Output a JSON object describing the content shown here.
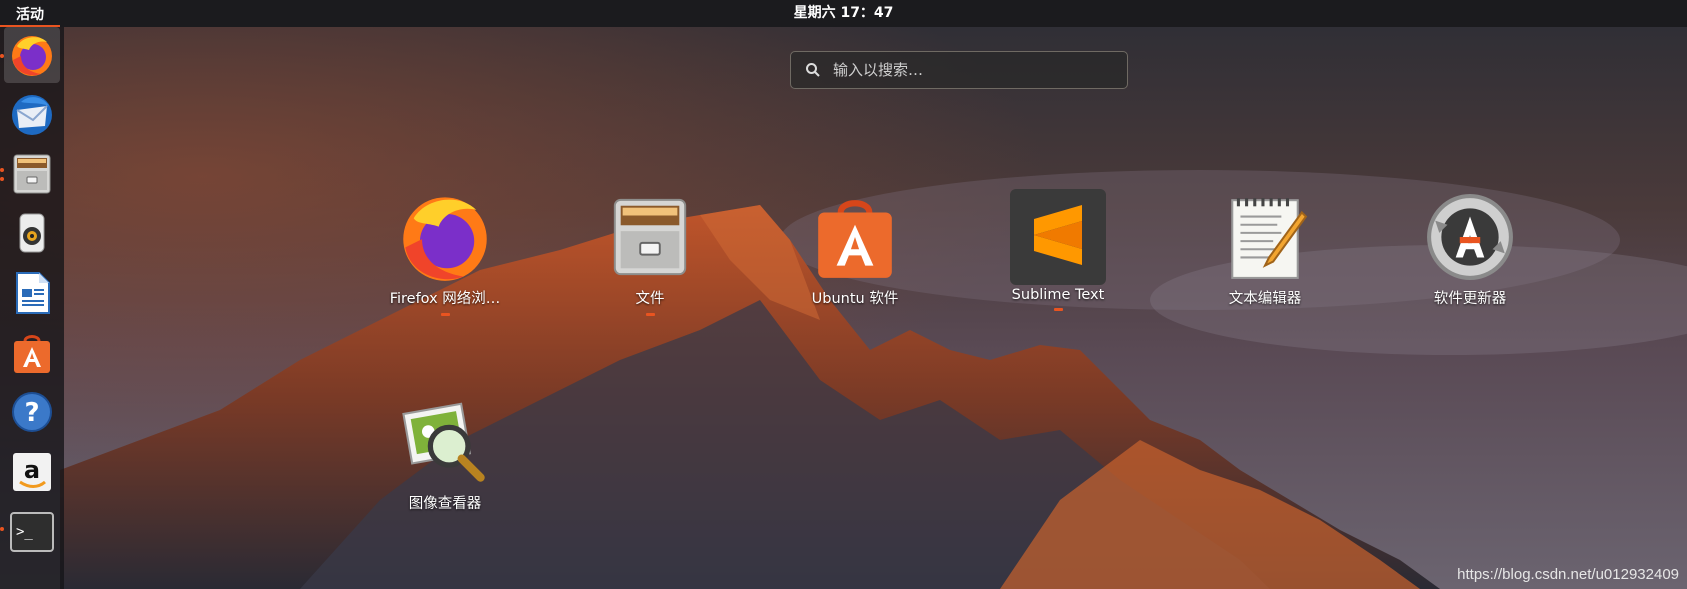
{
  "topbar": {
    "activities_label": "活动",
    "clock": "星期六 17：47"
  },
  "search": {
    "placeholder": "输入以搜索…"
  },
  "dock": {
    "items": [
      {
        "name": "firefox",
        "icon": "firefox-icon",
        "running": true,
        "active": true
      },
      {
        "name": "thunderbird",
        "icon": "thunderbird-icon",
        "running": false
      },
      {
        "name": "files",
        "icon": "files-icon",
        "running": true,
        "windows": 2
      },
      {
        "name": "rhythmbox",
        "icon": "rhythmbox-icon",
        "running": false
      },
      {
        "name": "libreoffice-writer",
        "icon": "writer-icon",
        "running": false
      },
      {
        "name": "ubuntu-software",
        "icon": "software-icon",
        "running": false
      },
      {
        "name": "help",
        "icon": "help-icon",
        "running": false
      },
      {
        "name": "amazon",
        "icon": "amazon-icon",
        "running": false
      },
      {
        "name": "terminal",
        "icon": "terminal-icon",
        "running": true
      }
    ]
  },
  "apps": [
    {
      "label": "Firefox 网络浏…",
      "icon": "firefox-icon",
      "running": true
    },
    {
      "label": "文件",
      "icon": "files-icon",
      "running": true
    },
    {
      "label": "Ubuntu 软件",
      "icon": "software-icon",
      "running": false
    },
    {
      "label": "Sublime Text",
      "icon": "sublime-text-icon",
      "running": true
    },
    {
      "label": "文本编辑器",
      "icon": "text-editor-icon",
      "running": false
    },
    {
      "label": "软件更新器",
      "icon": "software-updater-icon",
      "running": false
    },
    {
      "label": "图像查看器",
      "icon": "image-viewer-icon",
      "running": false
    }
  ],
  "watermark": "https://blog.csdn.net/u012932409",
  "colors": {
    "accent": "#e95420",
    "topbar": "#1b1b1e"
  }
}
